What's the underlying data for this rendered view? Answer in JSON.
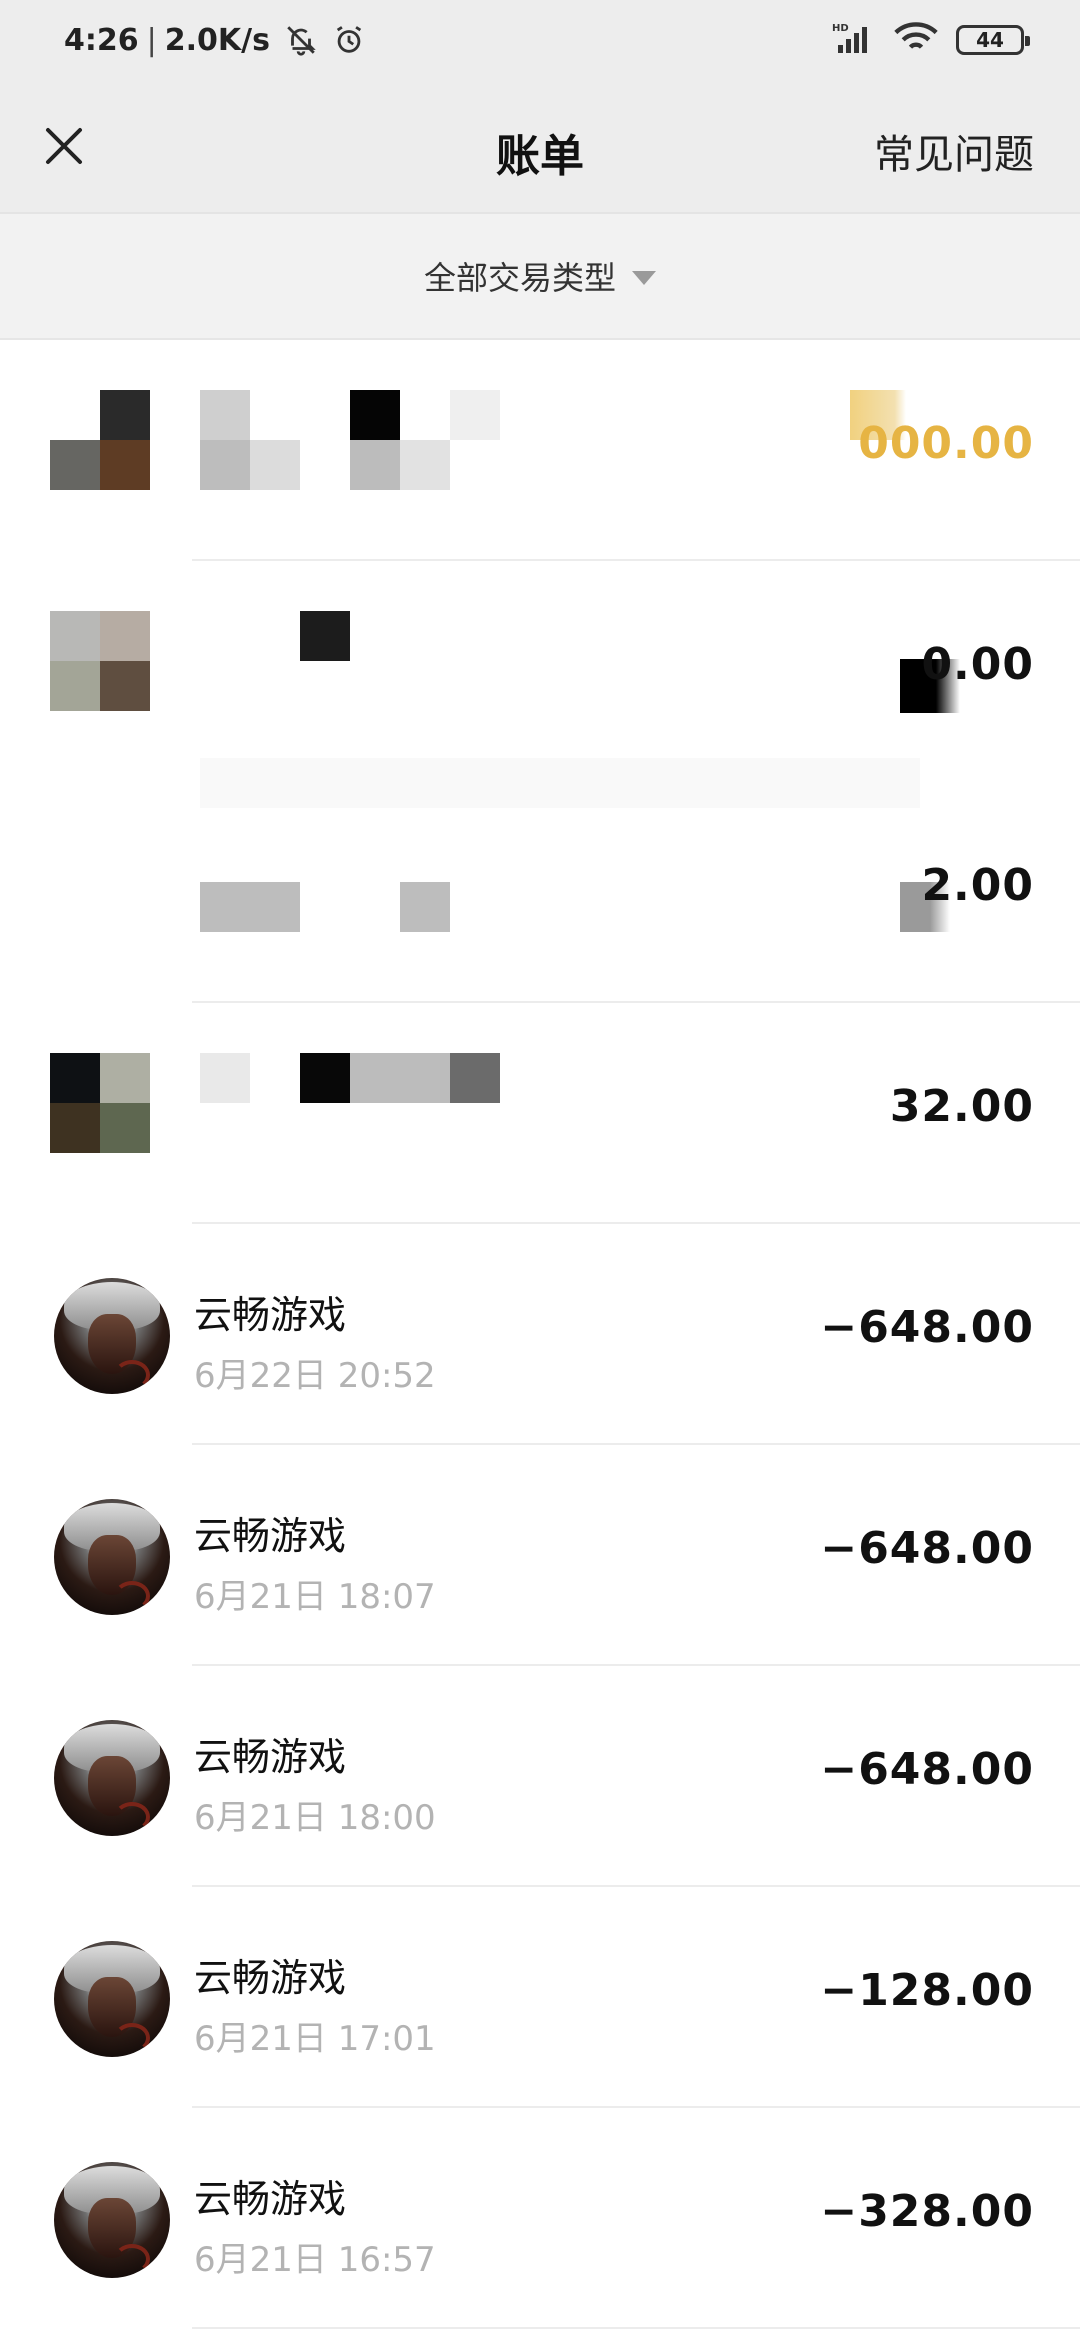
{
  "status_bar": {
    "time": "4:26",
    "speed": "2.0K/s",
    "battery": "44",
    "icons": [
      "bell-off-icon",
      "alarm-icon",
      "signal-icon",
      "wifi-icon",
      "battery-icon"
    ]
  },
  "header": {
    "title": "账单",
    "faq": "常见问题"
  },
  "filter": {
    "label": "全部交易类型"
  },
  "censored_rows": [
    {
      "amount_visible": "000.00"
    },
    {
      "amount_visible": "0.00"
    },
    {
      "amount_visible": "2.00"
    },
    {
      "amount_visible": "32.00"
    }
  ],
  "transactions": [
    {
      "title": "云畅游戏",
      "time": "6月22日 20:52",
      "amount": "−648.00"
    },
    {
      "title": "云畅游戏",
      "time": "6月21日 18:07",
      "amount": "−648.00"
    },
    {
      "title": "云畅游戏",
      "time": "6月21日 18:00",
      "amount": "−648.00"
    },
    {
      "title": "云畅游戏",
      "time": "6月21日 17:01",
      "amount": "−128.00"
    },
    {
      "title": "云畅游戏",
      "time": "6月21日 16:57",
      "amount": "−328.00"
    }
  ],
  "colors": {
    "accent_gold": "#e6b443",
    "muted_text": "#b3b3b3",
    "header_bg": "#ededed"
  }
}
